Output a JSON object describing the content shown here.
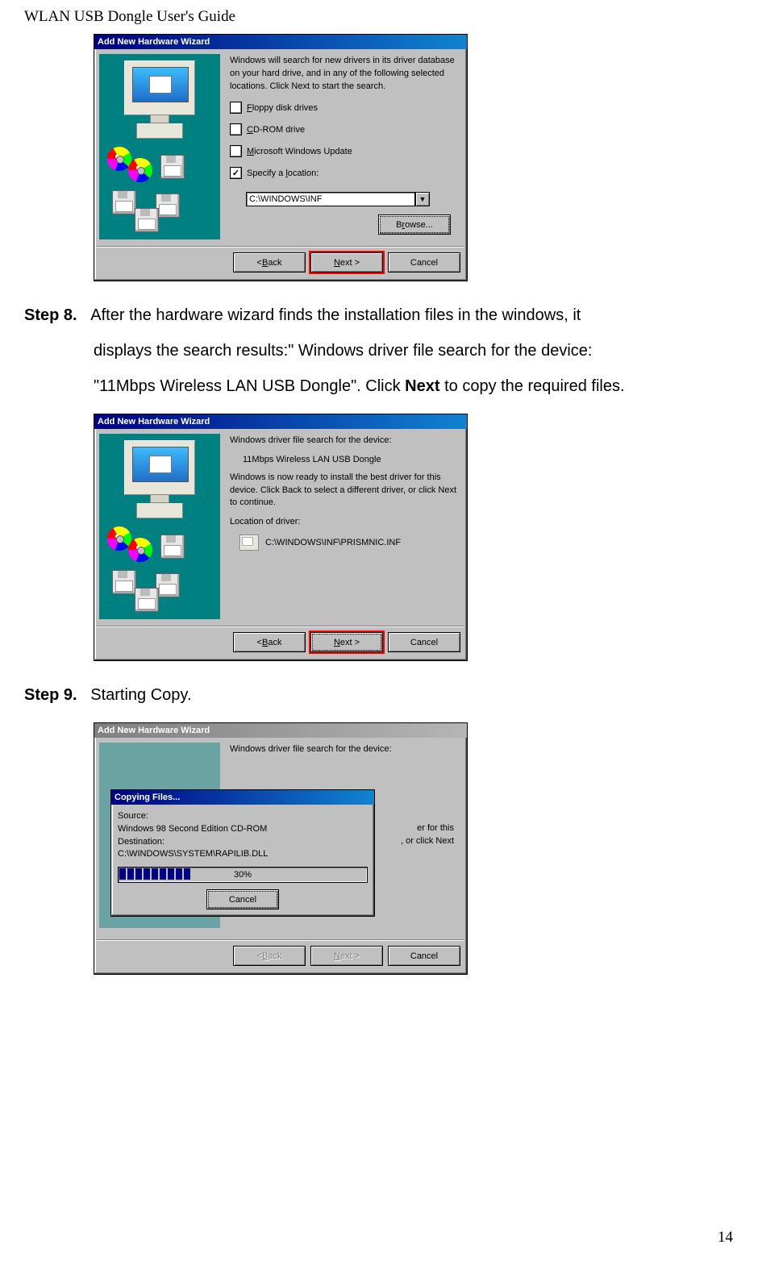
{
  "header": "WLAN USB Dongle User's Guide",
  "page_number": "14",
  "step8": {
    "label": "Step 8.",
    "line1": "After the hardware wizard finds the installation files in the windows, it",
    "line2": "displays the search results:\" Windows driver file search for the device:",
    "line3_pre": "\"11Mbps Wireless LAN USB Dongle\". Click ",
    "line3_bold": "Next",
    "line3_post": " to copy the required files."
  },
  "step9": {
    "label": "Step 9.",
    "text": "Starting Copy."
  },
  "dlg1": {
    "title": "Add New Hardware Wizard",
    "intro1": "Windows will search for new drivers in its driver database",
    "intro2": "on your hard drive, and in any of the following selected",
    "intro3": "locations. Click Next to start the search.",
    "opt_floppy_u": "F",
    "opt_floppy_rest": "loppy disk drives",
    "opt_cd_u": "C",
    "opt_cd_rest": "D-ROM drive",
    "opt_ms_u": "M",
    "opt_ms_rest": "icrosoft Windows Update",
    "opt_loc_pre": "Specify a ",
    "opt_loc_u": "l",
    "opt_loc_post": "ocation:",
    "path": "C:\\WINDOWS\\INF",
    "browse_pre": "B",
    "browse_u": "r",
    "browse_post": "owse...",
    "back_pre": "< ",
    "back_u": "B",
    "back_post": "ack",
    "next_pre": "",
    "next_u": "N",
    "next_post": "ext >",
    "cancel": "Cancel"
  },
  "dlg2": {
    "title": "Add New Hardware Wizard",
    "line1": "Windows driver file search for the device:",
    "device": "11Mbps Wireless LAN USB Dongle",
    "ready1": "Windows is now ready to install the best driver for this",
    "ready2": "device. Click Back to select a different driver, or click Next",
    "ready3": "to continue.",
    "loc_label": "Location of driver:",
    "driver_path": "C:\\WINDOWS\\INF\\PRISMNIC.INF",
    "back_pre": "< ",
    "back_u": "B",
    "back_post": "ack",
    "next_pre": "",
    "next_u": "N",
    "next_post": "ext >",
    "cancel": "Cancel"
  },
  "dlg3": {
    "title": "Add New Hardware Wizard",
    "line1": "Windows driver file search for the device:",
    "ready_part1": "er for this",
    "ready_part2": ", or click Next",
    "copy_title": "Copying Files...",
    "source_label": "Source:",
    "source_value": "Windows 98 Second Edition CD-ROM",
    "dest_label": "Destination:",
    "dest_value": "C:\\WINDOWS\\SYSTEM\\RAPILIB.DLL",
    "progress_text": "30%",
    "cancel_sub": "Cancel",
    "back_pre": "< ",
    "back_u": "B",
    "back_post": "ack",
    "next_pre": "",
    "next_u": "N",
    "next_post": "ext >",
    "cancel": "Cancel"
  }
}
